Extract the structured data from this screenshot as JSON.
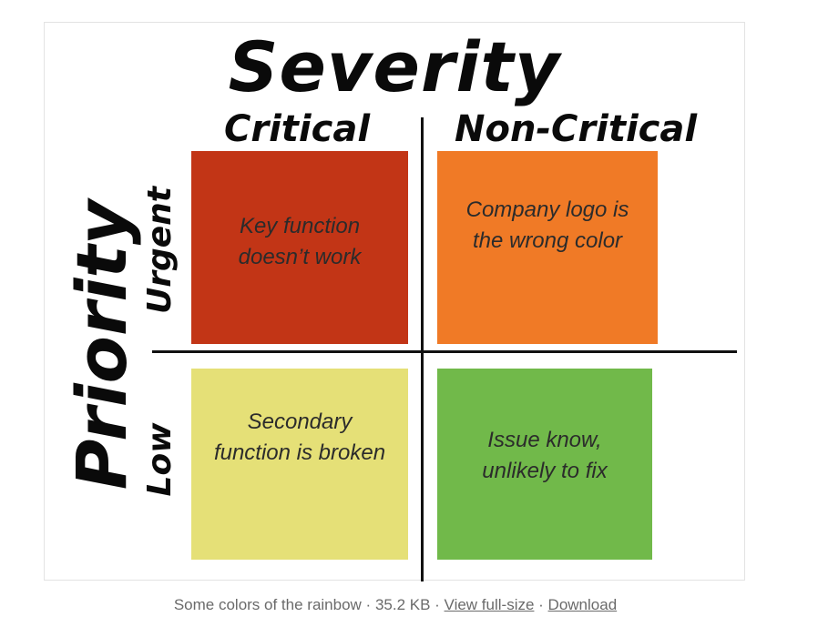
{
  "diagram": {
    "title": "Severity",
    "y_axis_label": "Priority",
    "columns": [
      "Critical",
      "Non-Critical"
    ],
    "rows": [
      "Urgent",
      "Low"
    ],
    "cells": {
      "urgent_critical": {
        "text": "Key function doesn’t work",
        "color": "#c23516"
      },
      "urgent_noncritical": {
        "text": "Company logo is the wrong color",
        "color": "#f07a26"
      },
      "low_critical": {
        "text": "Secondary function is broken",
        "color": "#e5e077"
      },
      "low_noncritical": {
        "text": "Issue know, unlikely to fix",
        "color": "#71b94a"
      }
    }
  },
  "caption": {
    "description": "Some colors of the rainbow",
    "separator": " · ",
    "size": "35.2 KB",
    "view_link": "View full-size",
    "download_link": "Download"
  }
}
